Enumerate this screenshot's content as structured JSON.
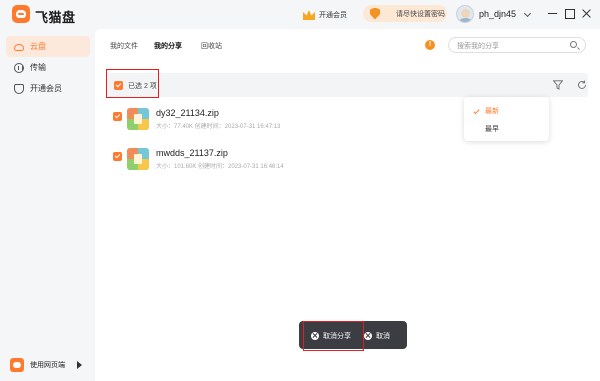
{
  "app": {
    "name": "飞猫盘"
  },
  "header": {
    "vip_label": "开通会员",
    "notice_label": "请尽快设置密码",
    "username": "ph_djn45"
  },
  "sidebar": {
    "items": [
      {
        "label": "云盘",
        "icon": "cloud-icon",
        "active": true
      },
      {
        "label": "传输",
        "icon": "transfer-icon",
        "active": false
      },
      {
        "label": "开通会员",
        "icon": "vip-icon",
        "active": false
      }
    ],
    "web_entry": "使用网页端"
  },
  "tabs": [
    {
      "label": "我的文件",
      "active": false
    },
    {
      "label": "我的分享",
      "active": true
    },
    {
      "label": "回收站",
      "active": false
    }
  ],
  "search": {
    "placeholder": "搜索我的分享"
  },
  "selection": {
    "label": "已选 2 项"
  },
  "files": [
    {
      "name": "dy32_21134.zip",
      "meta": "大小：77.40K   创建时间：2023-07-31 16:47:13",
      "checked": true
    },
    {
      "name": "mwdds_21137.zip",
      "meta": "大小：101.60K   创建时间：2023-07-31 16:46:14",
      "checked": true
    }
  ],
  "sort_menu": {
    "items": [
      {
        "label": "最新",
        "selected": true
      },
      {
        "label": "最早",
        "selected": false
      }
    ]
  },
  "actions": {
    "cancel_share": "取消分享",
    "cancel": "取消"
  },
  "colors": {
    "accent": "#ff7a2e",
    "highlight": "#e02020"
  }
}
